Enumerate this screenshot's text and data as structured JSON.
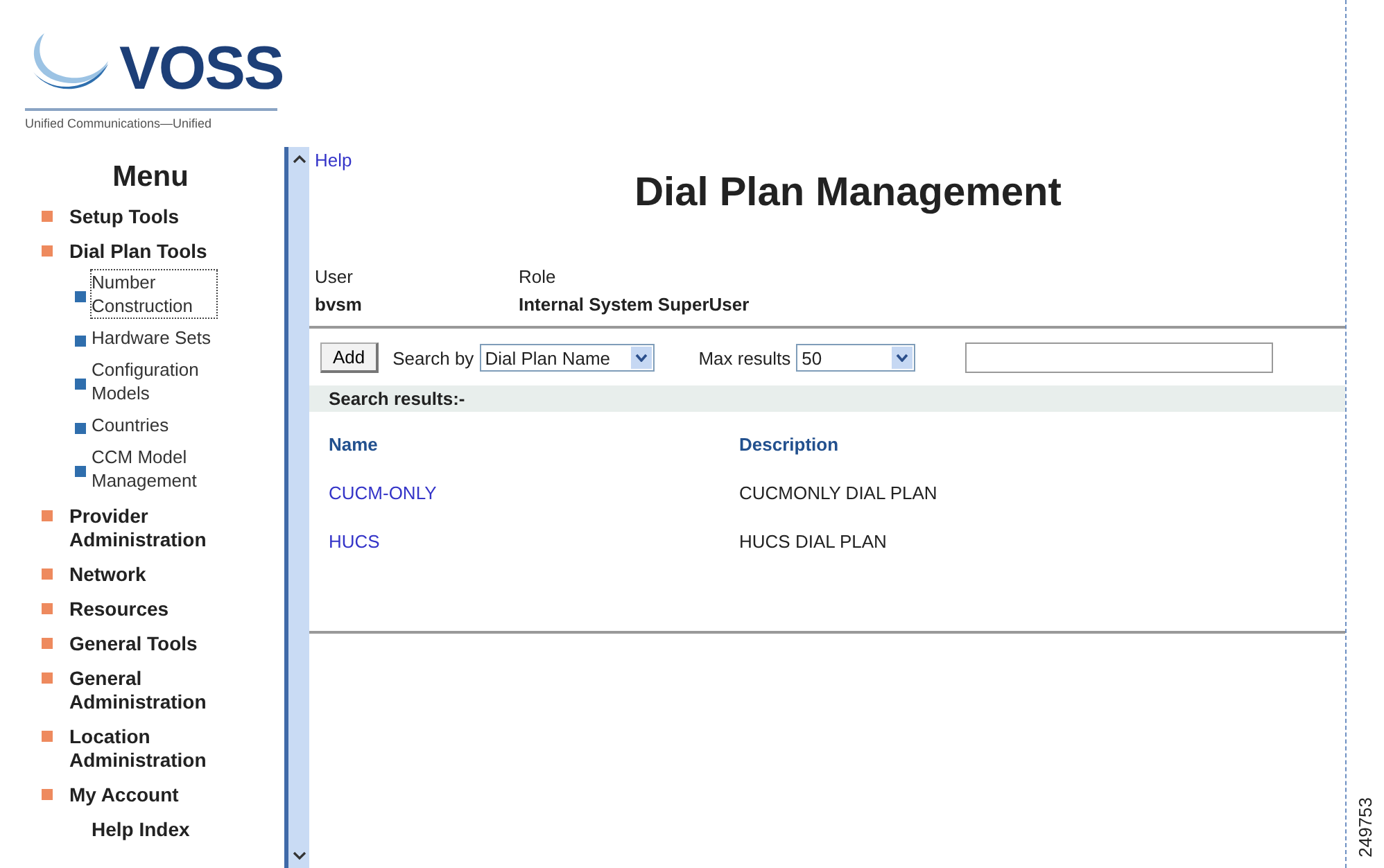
{
  "logo": {
    "wordmark": "VOSS",
    "tagline": "Unified Communications—Unified"
  },
  "menu": {
    "title": "Menu",
    "items": [
      {
        "label": "Setup Tools"
      },
      {
        "label": "Dial Plan Tools",
        "children": [
          {
            "label": "Number Construction",
            "focused": true
          },
          {
            "label": "Hardware Sets",
            "focused": false
          },
          {
            "label": "Configuration Models",
            "focused": false
          },
          {
            "label": "Countries",
            "focused": false
          },
          {
            "label": "CCM Model Management",
            "focused": false
          }
        ]
      },
      {
        "label": "Provider Administration"
      },
      {
        "label": "Network"
      },
      {
        "label": "Resources"
      },
      {
        "label": "General Tools"
      },
      {
        "label": "General Administration"
      },
      {
        "label": "Location Administration"
      },
      {
        "label": "My Account"
      }
    ],
    "footer": "Help Index"
  },
  "help_link": "Help",
  "title": "Dial Plan Management",
  "user_info": {
    "user_label": "User",
    "user": "bvsm",
    "role_label": "Role",
    "role": "Internal System SuperUser"
  },
  "toolbar": {
    "add": "Add",
    "search_by_label": "Search by",
    "search_by": "Dial Plan Name",
    "max_label": "Max results",
    "max": "50"
  },
  "results_label": "Search results:-",
  "table": {
    "columns": [
      "Name",
      "Description"
    ],
    "rows": [
      {
        "name": "CUCM-ONLY",
        "description": "CUCMONLY DIAL PLAN"
      },
      {
        "name": "HUCS",
        "description": "HUCS DIAL PLAN"
      }
    ]
  },
  "figure_number": "249753"
}
